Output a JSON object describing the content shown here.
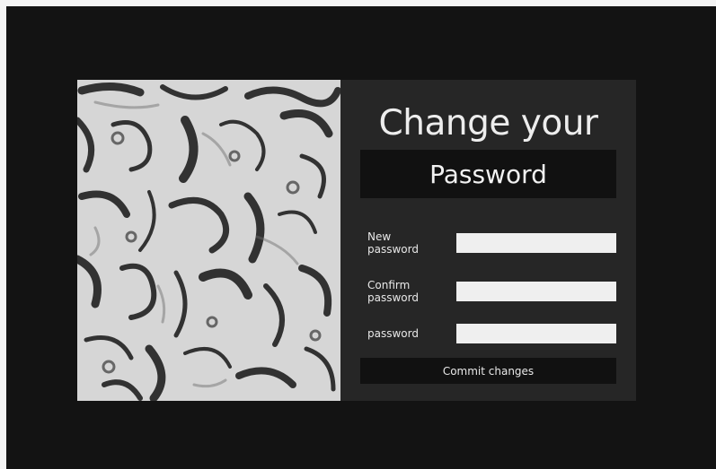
{
  "form": {
    "title": "Change your",
    "subtitle": "Password",
    "fields": [
      {
        "label": "New password",
        "value": "",
        "placeholder": ""
      },
      {
        "label": "Confirm password",
        "value": "",
        "placeholder": ""
      },
      {
        "label": "password",
        "value": "",
        "placeholder": ""
      }
    ],
    "submit_label": "Commit changes"
  },
  "colors": {
    "background": "#131313",
    "card": "#262626",
    "box": "#111111",
    "input": "#efefef",
    "art_background": "#d6d6d6",
    "art_strokes": "#1c1c1c"
  },
  "icons": {
    "decoration": "abstract-brush-pattern"
  }
}
